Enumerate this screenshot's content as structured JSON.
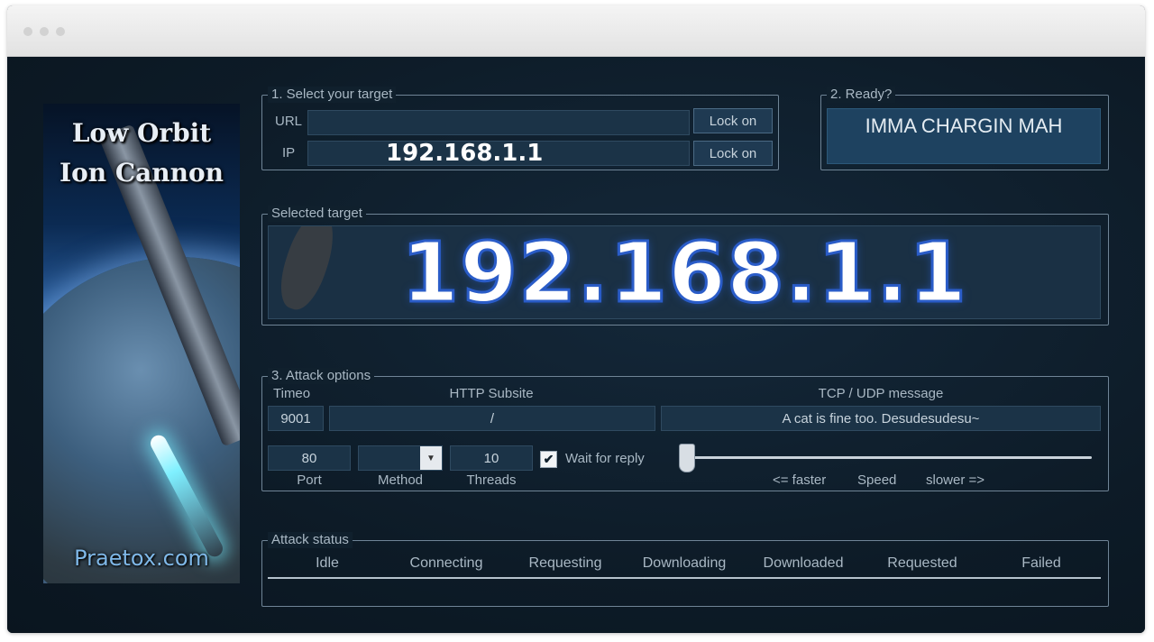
{
  "banner": {
    "title_line1": "Low Orbit",
    "title_line2": "Ion Cannon",
    "site": "Praetox.com"
  },
  "target": {
    "legend": "1. Select your target",
    "url_label": "URL",
    "ip_label": "IP",
    "url_value": "",
    "ip_value": "192.168.1.1",
    "lock_on_label": "Lock on"
  },
  "ready": {
    "legend": "2. Ready?",
    "button_label": "IMMA CHARGIN MAH"
  },
  "selected_target": {
    "legend": "Selected target",
    "value": "192.168.1.1"
  },
  "options": {
    "legend": "3. Attack options",
    "timeout_label": "Timeo",
    "timeout_value": "9001",
    "http_label": "HTTP Subsite",
    "http_value": "/",
    "message_label": "TCP / UDP message",
    "message_value": "A cat is fine too. Desudesudesu~",
    "port_value": "80",
    "port_label": "Port",
    "method_label": "Method",
    "method_value": "",
    "threads_value": "10",
    "threads_label": "Threads",
    "wait_label": "Wait for reply",
    "wait_checked": true,
    "speed_faster": "<= faster",
    "speed_label": "Speed",
    "speed_slower": "slower =>",
    "speed_level": 0.0
  },
  "status": {
    "legend": "Attack status",
    "columns": [
      "Idle",
      "Connecting",
      "Requesting",
      "Downloading",
      "Downloaded",
      "Requested",
      "Failed"
    ]
  },
  "colors": {
    "background": "#0d1b27",
    "field": "#1b3347",
    "text": "#a9b8c4",
    "ip_stroke": "#2a5cc8"
  }
}
